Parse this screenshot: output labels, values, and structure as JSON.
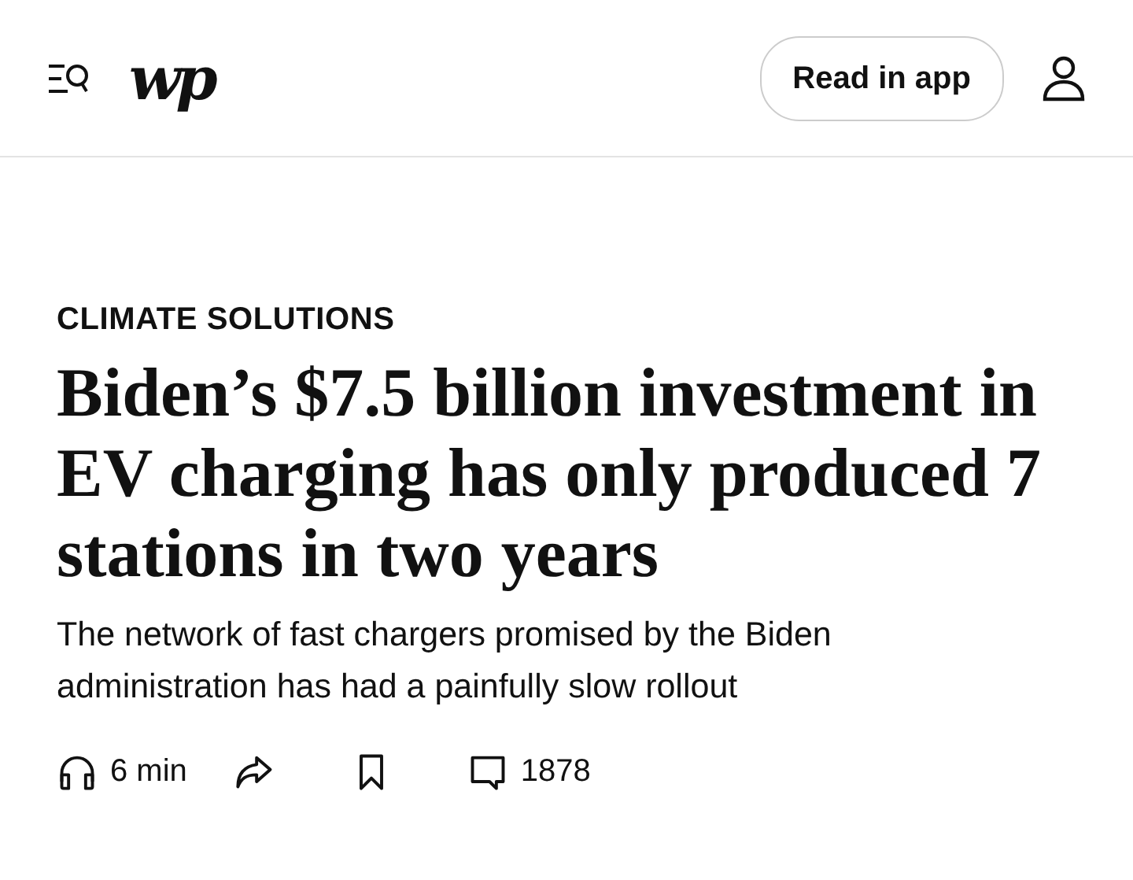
{
  "header": {
    "logo": "wp",
    "button": "Read in app"
  },
  "article": {
    "kicker": "CLIMATE SOLUTIONS",
    "headline": "Biden’s $7.5 billion investment in EV charging has only produced 7 stations in two years",
    "subtitle": "The network of fast chargers promised by the Biden administration has had a painfully slow rollout"
  },
  "actions": [
    {
      "kind": "listen",
      "label": "6 min"
    },
    {
      "kind": "share"
    },
    {
      "kind": "save"
    },
    {
      "kind": "comments",
      "label": "1878"
    }
  ]
}
